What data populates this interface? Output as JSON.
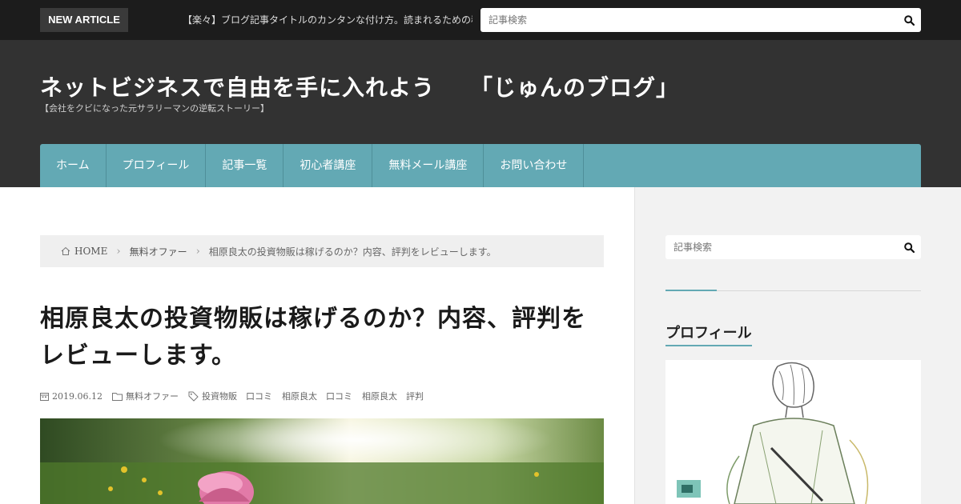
{
  "topbar": {
    "badge": "NEW ARTICLE",
    "ticker": "【楽々】ブログ記事タイトルのカンタンな付け方。読まれるための秘訣",
    "search_placeholder": "記事検索"
  },
  "header": {
    "title": "ネットビジネスで自由を手に入れよう　　「じゅんのブログ」",
    "tagline": "【会社をクビになった元サラリーマンの逆転ストーリー】"
  },
  "nav": {
    "items": [
      {
        "label": "ホーム"
      },
      {
        "label": "プロフィール"
      },
      {
        "label": "記事一覧"
      },
      {
        "label": "初心者講座"
      },
      {
        "label": "無料メール講座"
      },
      {
        "label": "お問い合わせ"
      }
    ]
  },
  "breadcrumb": {
    "home": "HOME",
    "category": "無料オファー",
    "current": "相原良太の投資物販は稼げるのか？内容、評判をレビューします。"
  },
  "article": {
    "title": "相原良太の投資物販は稼げるのか？内容、評判をレビューします。",
    "date": "2019.06.12",
    "category": "無料オファー",
    "tags": [
      "投資物販　口コミ",
      "相原良太　口コミ",
      "相原良太　評判"
    ]
  },
  "sidebar": {
    "search_placeholder": "記事検索",
    "profile_title": "プロフィール"
  },
  "colors": {
    "accent": "#63a9b4",
    "topbar_bg": "#1c1c1c",
    "header_bg": "#323232"
  }
}
